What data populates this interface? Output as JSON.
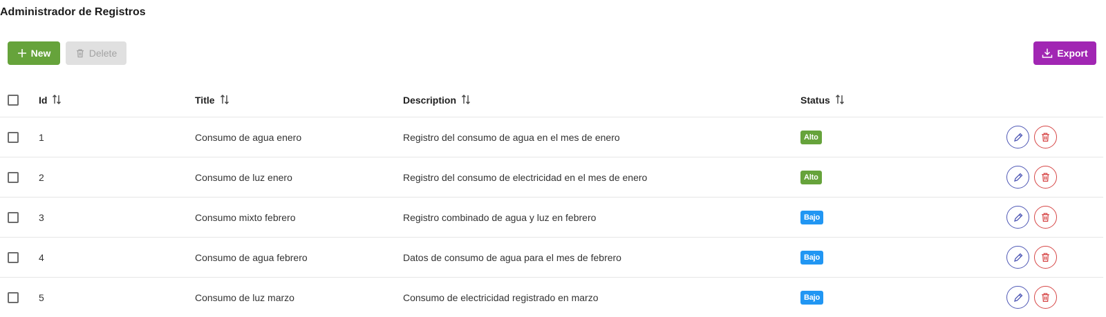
{
  "page": {
    "title": "Administrador de Registros"
  },
  "toolbar": {
    "new_label": "New",
    "delete_label": "Delete",
    "export_label": "Export"
  },
  "colors": {
    "new": "#66a33b",
    "delete_disabled": "#e0e0e0",
    "export": "#a126b3",
    "status_alto": "#66a33b",
    "status_bajo": "#2196f3",
    "edit_outline": "#4e57b5",
    "delete_outline": "#d64545"
  },
  "table": {
    "headers": {
      "id": "Id",
      "title": "Title",
      "description": "Description",
      "status": "Status"
    },
    "rows": [
      {
        "id": "1",
        "title": "Consumo de agua enero",
        "description": "Registro del consumo de agua en el mes de enero",
        "status": "Alto"
      },
      {
        "id": "2",
        "title": "Consumo de luz enero",
        "description": "Registro del consumo de electricidad en el mes de enero",
        "status": "Alto"
      },
      {
        "id": "3",
        "title": "Consumo mixto febrero",
        "description": "Registro combinado de agua y luz en febrero",
        "status": "Bajo"
      },
      {
        "id": "4",
        "title": "Consumo de agua febrero",
        "description": "Datos de consumo de agua para el mes de febrero",
        "status": "Bajo"
      },
      {
        "id": "5",
        "title": "Consumo de luz marzo",
        "description": "Consumo de electricidad registrado en marzo",
        "status": "Bajo"
      }
    ]
  }
}
